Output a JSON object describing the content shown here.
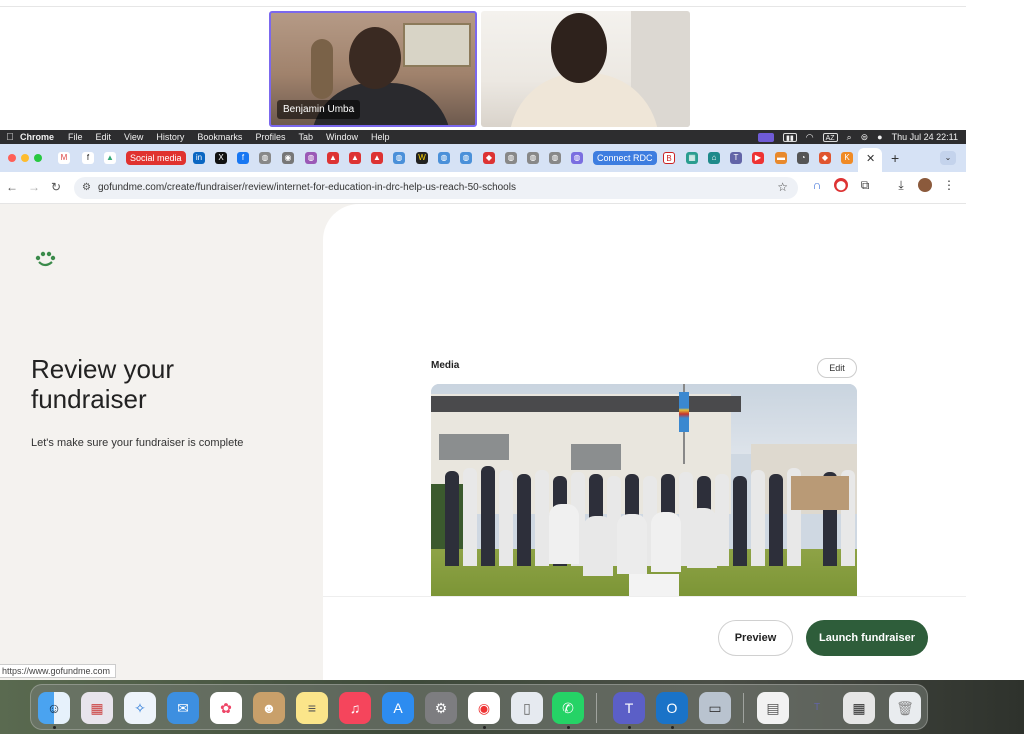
{
  "call": {
    "participant_1_name": "Benjamin Umba"
  },
  "menubar": {
    "apple_glyph": "",
    "app_name": "Chrome",
    "items": [
      "File",
      "Edit",
      "View",
      "History",
      "Bookmarks",
      "Profiles",
      "Tab",
      "Window",
      "Help"
    ],
    "input_source": "AZ",
    "datetime": "Thu Jul 24  22:11"
  },
  "tabs": {
    "social_media_label": "Social media",
    "connect_rdc_label": "Connect RDC"
  },
  "address": {
    "url": "gofundme.com/create/fundraiser/review/internet-for-education-in-drc-help-us-reach-50-schools"
  },
  "page": {
    "title": "Review your fundraiser",
    "subtitle": "Let's make sure your fundraiser is complete",
    "media_label": "Media",
    "edit_label": "Edit",
    "preview_label": "Preview",
    "launch_label": "Launch fundraiser"
  },
  "status_bar": {
    "url": "https://www.gofundme.com"
  },
  "colors": {
    "launch_button": "#2e5d3a",
    "page_background": "#f4f2ef",
    "tab_bar": "#d6e2f5",
    "active_speaker_border": "#7b68ee",
    "social_media_chip": "#e0322f",
    "connect_rdc_chip": "#3d7de0"
  }
}
